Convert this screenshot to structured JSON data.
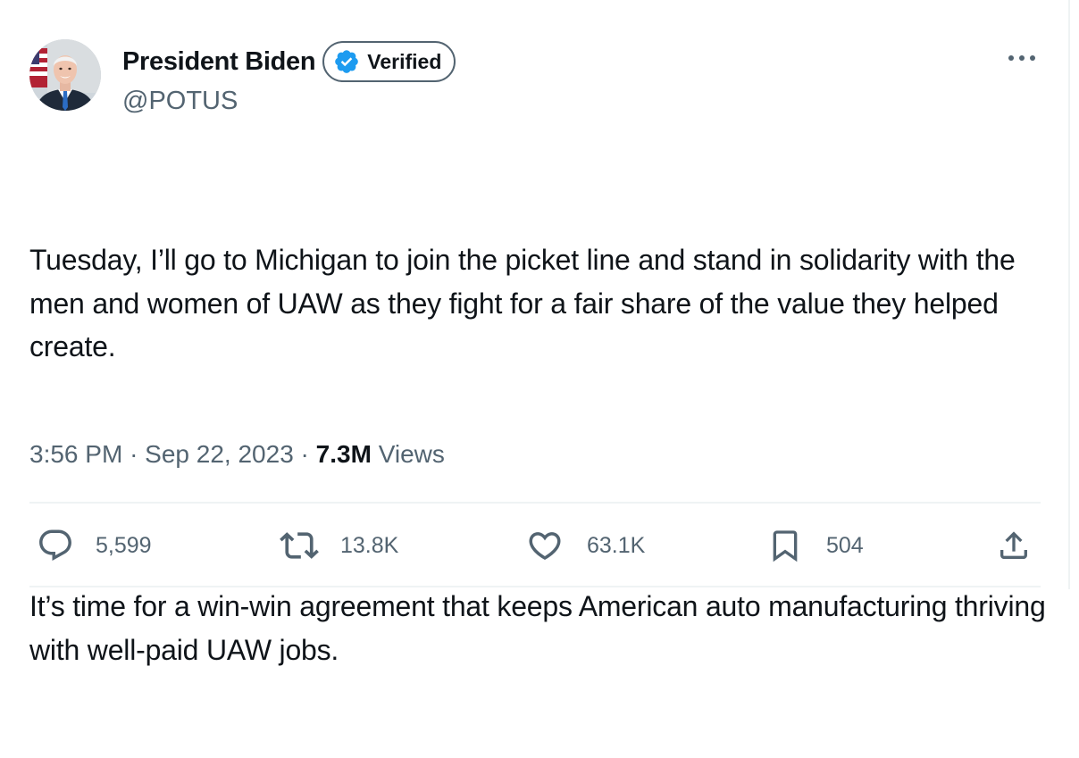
{
  "author": {
    "display_name": "President Biden",
    "verified_label": "Verified",
    "handle": "@POTUS"
  },
  "more_label": "···",
  "tweet": {
    "paragraph_1": "Tuesday, I’ll go to Michigan to join the picket line and stand in solidarity with the men and women of UAW as they fight for a fair share of the value they helped create.",
    "paragraph_2": "It’s time for a win-win agreement that keeps American auto manufacturing thriving with well-paid UAW jobs."
  },
  "meta": {
    "time": "3:56 PM",
    "separator": "·",
    "date": "Sep 22, 2023",
    "views_count": "7.3M",
    "views_label": "Views"
  },
  "actions": {
    "replies": "5,599",
    "reposts": "13.8K",
    "likes": "63.1K",
    "bookmarks": "504"
  },
  "colors": {
    "text": "#0f1419",
    "secondary": "#536471",
    "verified_blue": "#1d9bf0",
    "divider": "#eff3f4"
  },
  "icons": {
    "verified": "verified-badge-icon",
    "more": "more-icon",
    "reply": "reply-icon",
    "repost": "repost-icon",
    "like": "heart-icon",
    "bookmark": "bookmark-icon",
    "share": "share-icon"
  }
}
